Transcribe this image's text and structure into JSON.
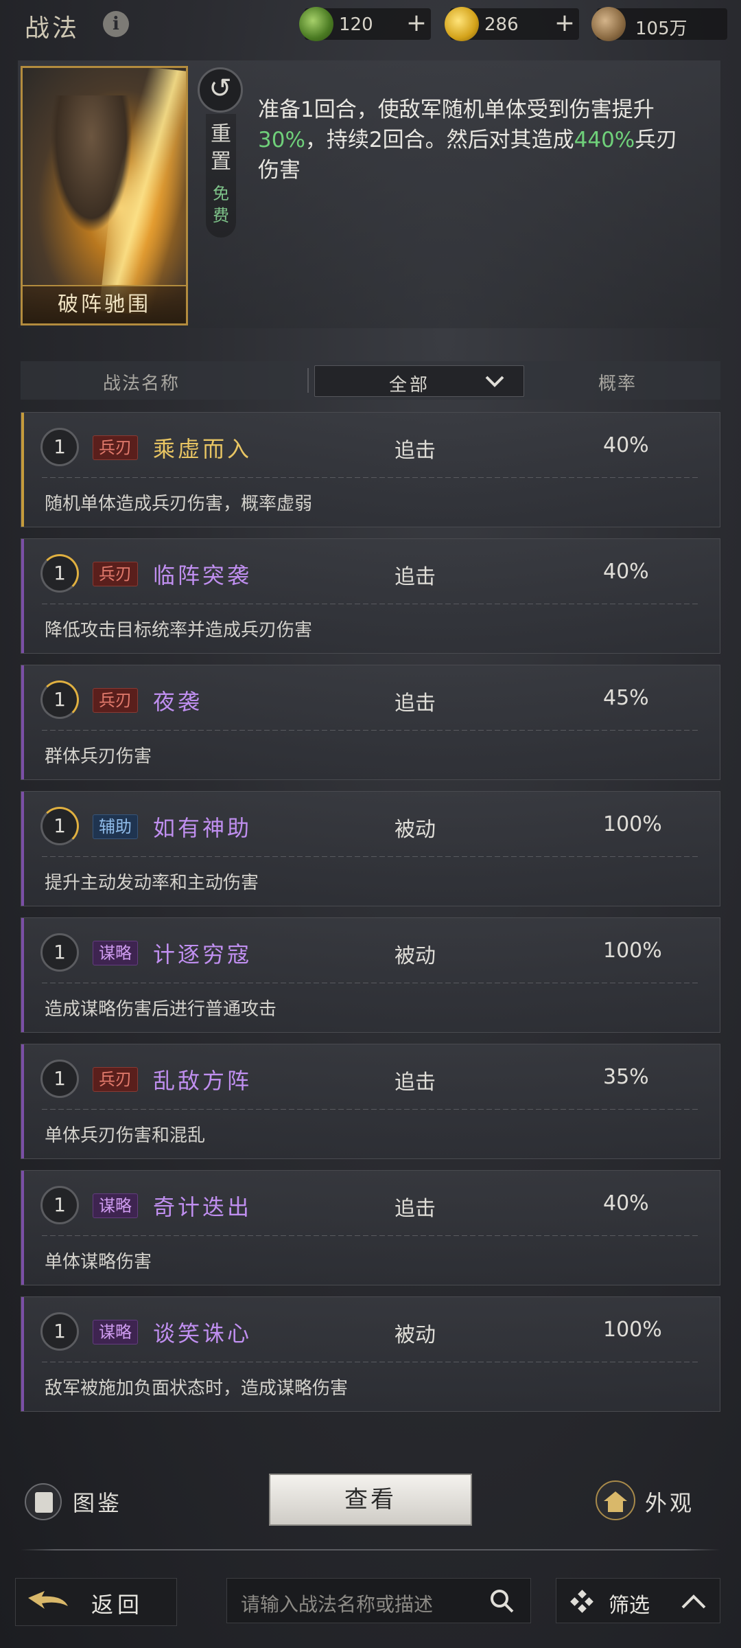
{
  "header": {
    "title": "战法",
    "info_icon": "info-icon",
    "currencies": [
      {
        "icon": "jade-coin-icon",
        "value": "120",
        "color": "#6f9a3a"
      },
      {
        "icon": "gold-coin-icon",
        "value": "286",
        "color": "#d8a925"
      },
      {
        "icon": "copper-coin-icon",
        "value": "105万",
        "color": "#9a7a52"
      }
    ]
  },
  "hero": {
    "card_name": "破阵驰围",
    "reset_label": "重置",
    "free_label": "免费",
    "desc_parts": [
      "准备1回合，使敌军随机单体受到伤害提升",
      "30%",
      "，持续2回合。然后对其造成",
      "440%",
      "兵刃伤害"
    ]
  },
  "list_header": {
    "name_col": "战法名称",
    "filter_value": "全部",
    "prob_col": "概率"
  },
  "skills": [
    {
      "level": "1",
      "tag": "兵刃",
      "name": "乘虚而入",
      "type": "追击",
      "prob": "40%",
      "desc": "随机单体造成兵刃伤害，概率虚弱"
    },
    {
      "level": "1",
      "tag": "兵刃",
      "name": "临阵突袭",
      "type": "追击",
      "prob": "40%",
      "desc": "降低攻击目标统率并造成兵刃伤害"
    },
    {
      "level": "1",
      "tag": "兵刃",
      "name": "夜袭",
      "type": "追击",
      "prob": "45%",
      "desc": "群体兵刃伤害"
    },
    {
      "level": "1",
      "tag": "辅助",
      "name": "如有神助",
      "type": "被动",
      "prob": "100%",
      "desc": "提升主动发动率和主动伤害"
    },
    {
      "level": "1",
      "tag": "谋略",
      "name": "计逐穷寇",
      "type": "被动",
      "prob": "100%",
      "desc": "造成谋略伤害后进行普通攻击"
    },
    {
      "level": "1",
      "tag": "兵刃",
      "name": "乱敌方阵",
      "type": "追击",
      "prob": "35%",
      "desc": "单体兵刃伤害和混乱"
    },
    {
      "level": "1",
      "tag": "谋略",
      "name": "奇计迭出",
      "type": "追击",
      "prob": "40%",
      "desc": "单体谋略伤害"
    },
    {
      "level": "1",
      "tag": "谋略",
      "name": "谈笑诛心",
      "type": "被动",
      "prob": "100%",
      "desc": "敌军被施加负面状态时，造成谋略伤害"
    }
  ],
  "bottom": {
    "tujian": "图鉴",
    "view": "查看",
    "waiguan": "外观",
    "back": "返回",
    "search_placeholder": "请输入战法名称或描述",
    "filter": "筛选"
  }
}
